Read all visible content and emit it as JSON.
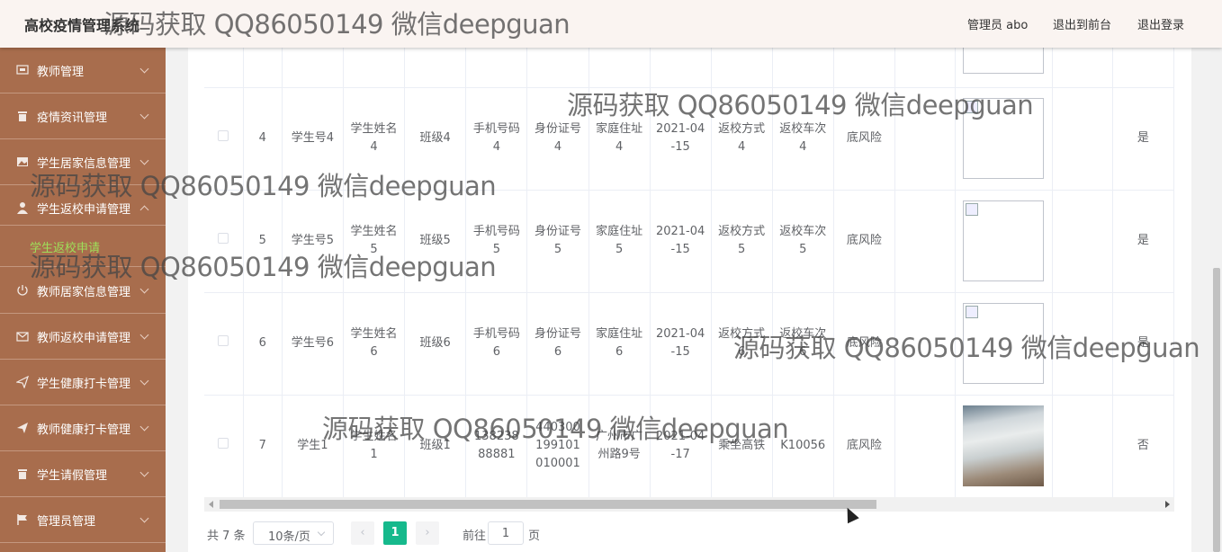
{
  "header": {
    "title": "高校疫情管理系统",
    "user": "管理员 abo",
    "to_front": "退出到前台",
    "logout": "退出登录"
  },
  "sidebar": {
    "items": [
      {
        "label": "教师管理",
        "icon": "monitor-icon"
      },
      {
        "label": "疫情资讯管理",
        "icon": "trash-icon"
      },
      {
        "label": "学生居家信息管理",
        "icon": "picture-icon"
      },
      {
        "label": "学生返校申请管理",
        "icon": "user-icon"
      },
      {
        "label": "教师居家信息管理",
        "icon": "power-icon"
      },
      {
        "label": "教师返校申请管理",
        "icon": "mail-icon"
      },
      {
        "label": "学生健康打卡管理",
        "icon": "send-icon"
      },
      {
        "label": "教师健康打卡管理",
        "icon": "send-icon"
      },
      {
        "label": "学生请假管理",
        "icon": "trash-icon"
      },
      {
        "label": "管理员管理",
        "icon": "flag-icon"
      }
    ],
    "sub_item": "学生返校申请"
  },
  "table": {
    "rows": [
      {
        "no": "",
        "stu_no": "",
        "name": "",
        "class": "",
        "phone": "",
        "id_card": "",
        "address": "",
        "date": "",
        "method": "",
        "train": "",
        "risk": "",
        "image": "placeholder",
        "flag": ""
      },
      {
        "no": "4",
        "stu_no": "学生号4",
        "name": "学生姓名4",
        "class": "班级4",
        "phone": "手机号码4",
        "id_card": "身份证号4",
        "address": "家庭住址4",
        "date": "2021-04-15",
        "method": "返校方式4",
        "train": "返校车次4",
        "risk": "底风险",
        "image": "broken",
        "flag": "是"
      },
      {
        "no": "5",
        "stu_no": "学生号5",
        "name": "学生姓名5",
        "class": "班级5",
        "phone": "手机号码5",
        "id_card": "身份证号5",
        "address": "家庭住址5",
        "date": "2021-04-15",
        "method": "返校方式5",
        "train": "返校车次5",
        "risk": "底风险",
        "image": "broken",
        "flag": "是"
      },
      {
        "no": "6",
        "stu_no": "学生号6",
        "name": "学生姓名6",
        "class": "班级6",
        "phone": "手机号码6",
        "id_card": "身份证号6",
        "address": "家庭住址6",
        "date": "2021-04-15",
        "method": "返校方式6",
        "train": "返校车次6",
        "risk": "底风险",
        "image": "broken",
        "flag": "是"
      },
      {
        "no": "7",
        "stu_no": "学生1",
        "name": "学生姓名1",
        "class": "班级1",
        "phone": "13823888881",
        "id_card": "440300199101010001",
        "address": "广州市广州路9号",
        "date": "2021-04-17",
        "method": "乘坐高铁",
        "train": "K10056",
        "risk": "底风险",
        "image": "photo",
        "flag": "否"
      }
    ]
  },
  "pagination": {
    "total": "共 7 条",
    "page_size": "10条/页",
    "current": "1",
    "goto_label": "前往",
    "goto_value": "1",
    "unit": "页"
  },
  "watermark": "源码获取 QQ86050149 微信deepguan",
  "colors": {
    "sidebar_bg": "#a86d4d",
    "header_bg": "#faf4f1",
    "active_sub": "#9ee05a",
    "pager_active": "#16b98c"
  }
}
